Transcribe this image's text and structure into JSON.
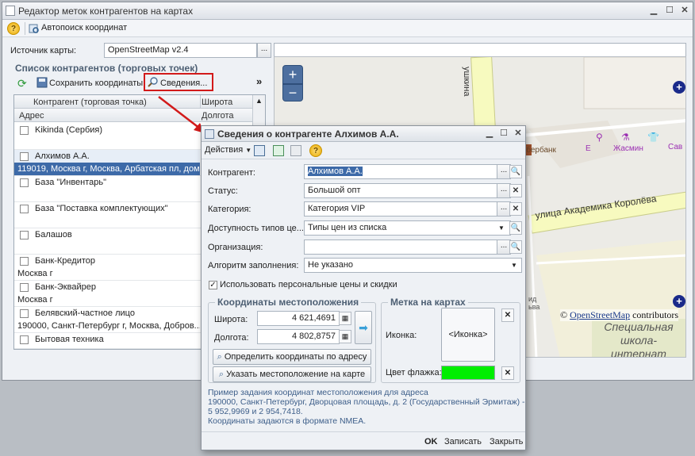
{
  "window": {
    "title": "Редактор меток контрагентов на картах"
  },
  "toolbar": {
    "autosearch_label": "Автопоиск координат"
  },
  "source": {
    "label": "Источник карты:",
    "value": "OpenStreetMap v2.4"
  },
  "list": {
    "group_title": "Список контрагентов (торговых точек)",
    "save_label": "Сохранить координаты",
    "info_label": "Сведения...",
    "col_name": "Контрагент (торговая точка)",
    "col_lat": "Широта",
    "col_addr": "Адрес",
    "col_lon": "Долгота",
    "rows": [
      {
        "name": "Kikinda (Сербия)",
        "addr": ""
      },
      {
        "name": "Алхимов А.А.",
        "addr": "119019, Москва г, Москва, Арбатская пл, дом..."
      },
      {
        "name": "База \"Инвентарь\"",
        "addr": ""
      },
      {
        "name": "База \"Поставка комплектующих\"",
        "addr": ""
      },
      {
        "name": "Балашов",
        "addr": ""
      },
      {
        "name": "Банк-Кредитор",
        "addr": "Москва г"
      },
      {
        "name": "Банк-Эквайрер",
        "addr": "Москва г"
      },
      {
        "name": "Белявский-частное лицо",
        "addr": "190000, Санкт-Петербург г, Москва, Добров..."
      },
      {
        "name": "Бытовая техника",
        "addr": ""
      }
    ]
  },
  "map": {
    "zoom_in": "+",
    "zoom_out": "−",
    "street_vert": "ушкина",
    "street_diag": "улица Академика Королёва",
    "poi_bank": "Сбербанк",
    "poi_jasmin": "Жасмин",
    "poi_e": "Е",
    "poi_sav": "Сав",
    "school": "Специальная школа-интернат",
    "side_text": "ид ьва",
    "attribution_link": "OpenStreetMap",
    "attribution_suffix": "contributors",
    "copyright": "©"
  },
  "dialog": {
    "title": "Сведения о контрагенте Алхимов А.А.",
    "actions_label": "Действия",
    "fields": {
      "kontragent": {
        "label": "Контрагент:",
        "value": "Алхимов А.А."
      },
      "status": {
        "label": "Статус:",
        "value": "Большой опт"
      },
      "category": {
        "label": "Категория:",
        "value": "Категория VIP"
      },
      "price_types": {
        "label": "Доступность типов це...",
        "value": "Типы цен из списка"
      },
      "org": {
        "label": "Организация:",
        "value": ""
      },
      "algo": {
        "label": "Алгоритм заполнения:",
        "value": "Не указано"
      }
    },
    "personal_prices": "Использовать персональные цены и скидки",
    "coords": {
      "title": "Координаты местоположения",
      "lat_label": "Широта:",
      "lat_value": "4 621,4691",
      "lon_label": "Долгота:",
      "lon_value": "4 802,8757",
      "btn_by_address": "Определить координаты по адресу",
      "btn_on_map": "Указать местоположение на карте"
    },
    "marker": {
      "title": "Метка на картах",
      "icon_label": "Иконка:",
      "icon_value": "<Иконка>",
      "flag_label": "Цвет флажка:",
      "flag_color": "#00ee00"
    },
    "hint": [
      "Пример задания координат местоположения для адреса",
      "190000, Санкт-Петербург, Дворцовая площадь, д. 2 (Государственный Эрмитаж) -",
      "5 952,9969 и 2 954,7418.",
      "Координаты задаются в формате NMEA."
    ],
    "ok": "OK",
    "save": "Записать",
    "close": "Закрыть"
  }
}
